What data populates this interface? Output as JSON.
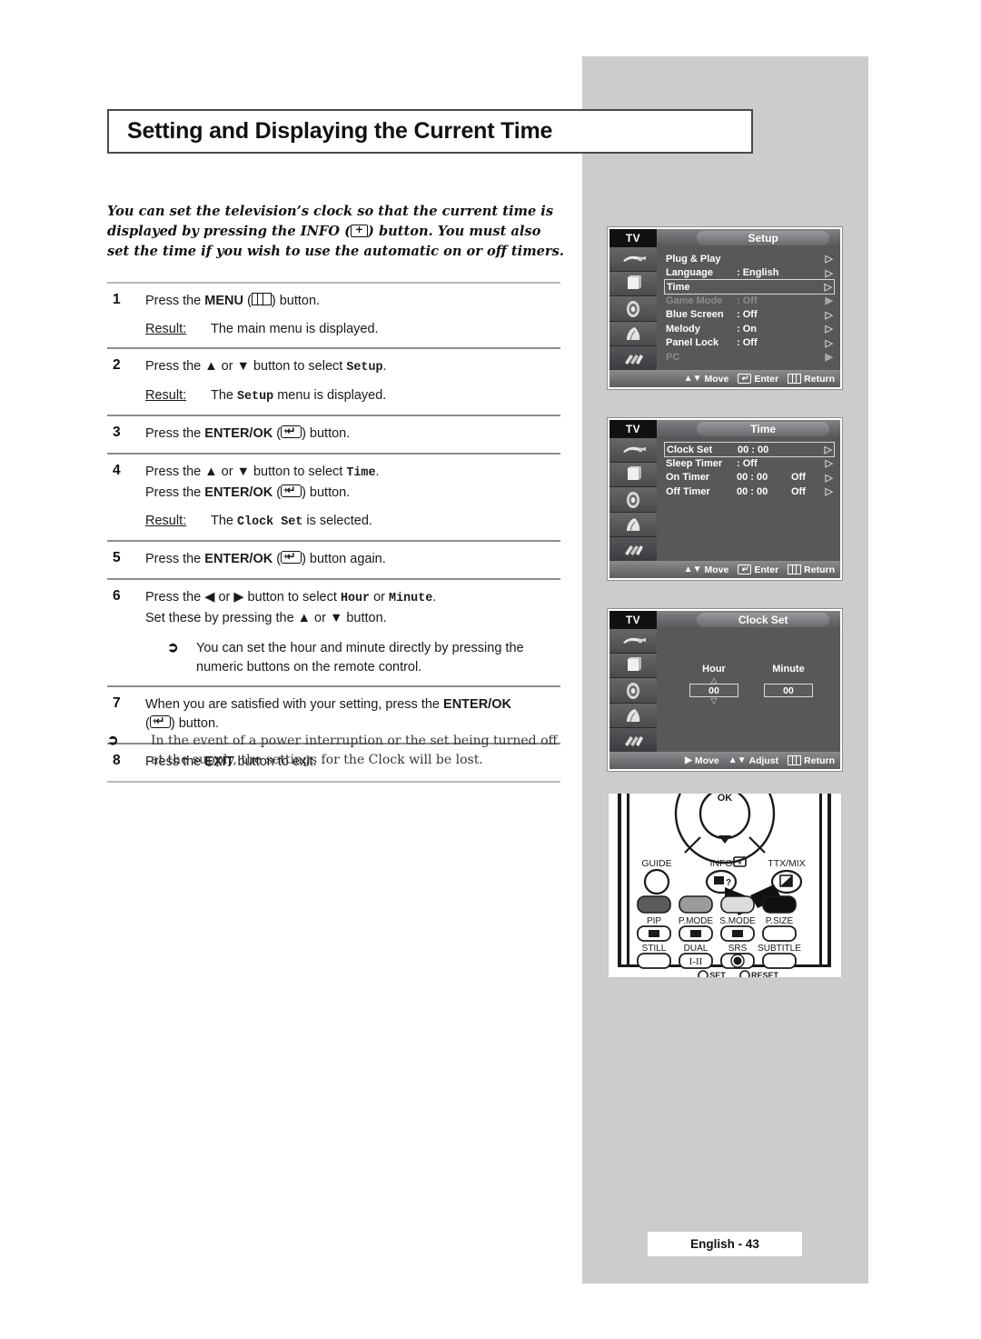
{
  "page": {
    "title": "Setting and Displaying the Current Time",
    "footer": "English - 43"
  },
  "intro": {
    "part1": "You can set the television’s clock so that the current time is displayed by pressing the INFO (",
    "icon": "info-icon",
    "part2": ") button. You must also set the time if you wish to use the automatic on or off timers."
  },
  "steps": [
    {
      "num": "1",
      "lines": [
        "Press the MENU (□) button."
      ],
      "line1_pre": "Press the ",
      "line1_bold": "MENU",
      "line1_icon": "menu-icon",
      "line1_post": ") button.",
      "result_label": "Result:",
      "result_text": "The main menu is displayed."
    },
    {
      "num": "2",
      "line1_pre": "Press the ▲ or ▼ button to select ",
      "line1_mono": "Setup",
      "line1_post": ".",
      "result_label": "Result:",
      "result_pre": "The ",
      "result_mono": "Setup",
      "result_post": " menu is displayed."
    },
    {
      "num": "3",
      "line1_pre": "Press the ",
      "line1_bold": "ENTER/OK",
      "line1_icon": "enter-icon",
      "line1_post": ") button."
    },
    {
      "num": "4",
      "line1_pre": "Press the ▲ or ▼ button to select ",
      "line1_mono": "Time",
      "line1_post": ".",
      "line2_pre": "Press the ",
      "line2_bold": "ENTER/OK",
      "line2_icon": "enter-icon",
      "line2_post": ") button.",
      "result_label": "Result:",
      "result_pre": "The ",
      "result_mono": "Clock Set",
      "result_post": " is selected."
    },
    {
      "num": "5",
      "line1_pre": "Press the ",
      "line1_bold": "ENTER/OK",
      "line1_icon": "enter-icon",
      "line1_post": ") button again."
    },
    {
      "num": "6",
      "line1_pre": "Press the ◀ or ▶ button to select ",
      "line1_mono": "Hour",
      "line1_mid": " or ",
      "line1_mono2": "Minute",
      "line1_post": ".",
      "line2": "Set these by pressing the ▲ or ▼ button.",
      "note": "You can set the hour and minute directly by pressing the numeric buttons on the remote control."
    },
    {
      "num": "7",
      "line1_pre": "When you are satisfied with your setting, press the ",
      "line1_bold": "ENTER/OK",
      "line1_icon": "enter-icon",
      "line1_post": ") button."
    },
    {
      "num": "8",
      "line1_pre": "Press the ",
      "line1_bold": "EXIT",
      "line1_post": " button to exit."
    }
  ],
  "bottom_note": {
    "mark": "➢",
    "text": "In the event of a power interruption or the set being turned off at the supply, the settings for the Clock will be lost."
  },
  "osd": {
    "tv_label": "TV",
    "footer_move": "Move",
    "footer_enter": "Enter",
    "footer_return": "Return",
    "footer_adjust": "Adjust",
    "setup": {
      "title": "Setup",
      "rows": [
        {
          "label": "Plug & Play",
          "value": "",
          "value2": "",
          "arrow": "▷",
          "state": "normal",
          "selected": false
        },
        {
          "label": "Language",
          "value": ": English",
          "value2": "",
          "arrow": "▷",
          "state": "normal",
          "selected": false
        },
        {
          "label": "Time",
          "value": "",
          "value2": "",
          "arrow": "▷",
          "state": "normal",
          "selected": true
        },
        {
          "label": "Game Mode",
          "value": ": Off",
          "value2": "",
          "arrow": "▶",
          "state": "dim",
          "selected": false
        },
        {
          "label": "Blue Screen",
          "value": ": Off",
          "value2": "",
          "arrow": "▷",
          "state": "normal",
          "selected": false
        },
        {
          "label": "Melody",
          "value": ": On",
          "value2": "",
          "arrow": "▷",
          "state": "normal",
          "selected": false
        },
        {
          "label": "Panel Lock",
          "value": ": Off",
          "value2": "",
          "arrow": "▷",
          "state": "normal",
          "selected": false
        },
        {
          "label": "PC",
          "value": "",
          "value2": "",
          "arrow": "▶",
          "state": "dim",
          "selected": false
        }
      ]
    },
    "time": {
      "title": "Time",
      "rows": [
        {
          "label": "Clock Set",
          "value": "00 : 00",
          "value2": "",
          "arrow": "▷",
          "state": "normal",
          "selected": true
        },
        {
          "label": "Sleep Timer",
          "value": ": Off",
          "value2": "",
          "arrow": "▷",
          "state": "normal",
          "selected": false
        },
        {
          "label": "On Timer",
          "value": "00 : 00",
          "value2": "Off",
          "arrow": "▷",
          "state": "normal",
          "selected": false
        },
        {
          "label": "Off Timer",
          "value": "00 : 00",
          "value2": "Off",
          "arrow": "▷",
          "state": "normal",
          "selected": false
        }
      ]
    },
    "clock": {
      "title": "Clock Set",
      "hour_label": "Hour",
      "hour_value": "00",
      "minute_label": "Minute",
      "minute_value": "00"
    }
  },
  "remote": {
    "ok_label": "OK",
    "guide": "GUIDE",
    "info": "INFO",
    "ttxmix": "TTX/MIX",
    "pip": "PIP",
    "pmode": "P.MODE",
    "smode": "S.MODE",
    "psize": "P.SIZE",
    "still": "STILL",
    "dual": "DUAL",
    "dual_glyph": "I-II",
    "srs": "SRS",
    "subtitle": "SUBTITLE",
    "set": "SET",
    "reset": "RESET",
    "colors": [
      "#5b5b5b",
      "#9b9b9b",
      "#dcdcdc",
      "#101010"
    ]
  }
}
